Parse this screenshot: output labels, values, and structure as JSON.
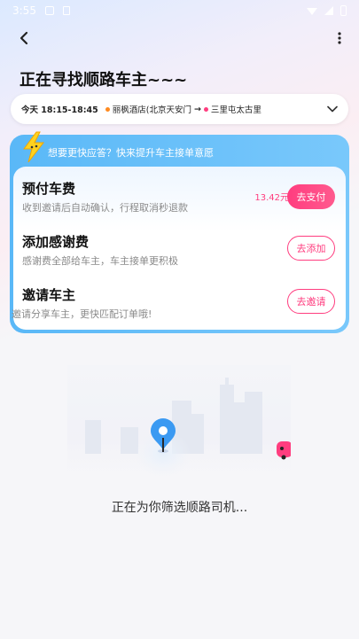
{
  "status_bar": {
    "time": "3:55"
  },
  "icons": {
    "back": "back-arrow-icon",
    "more": "more-vertical-icon",
    "dropdown": "chevron-down-icon",
    "bolt": "lightning-bolt-icon"
  },
  "page": {
    "title": "正在寻找顺路车主~~~"
  },
  "trip": {
    "time_range": "今天 18:15-18:45",
    "origin": "丽枫酒店(北京天安门",
    "arrow": "→",
    "destination": "三里屯太古里"
  },
  "boost": {
    "header": "想要更快应答？快来提升车主接单意愿",
    "options": [
      {
        "title": "预付车费",
        "desc": "收到邀请后自动确认，行程取消秒退款",
        "price": "13.42元",
        "button": "去支付"
      },
      {
        "title": "添加感谢费",
        "desc": "感谢费全部给车主，车主接单更积极",
        "button": "去添加"
      },
      {
        "title": "邀请车主",
        "desc": "邀请分享车主，更快匹配订单哦!",
        "button": "去邀请"
      }
    ]
  },
  "searching": {
    "text": "正在为你筛选顺路司机..."
  },
  "colors": {
    "accent_pink": "#ff3d7f",
    "accent_blue": "#5ab8f7",
    "pin_blue": "#3b9af2"
  }
}
